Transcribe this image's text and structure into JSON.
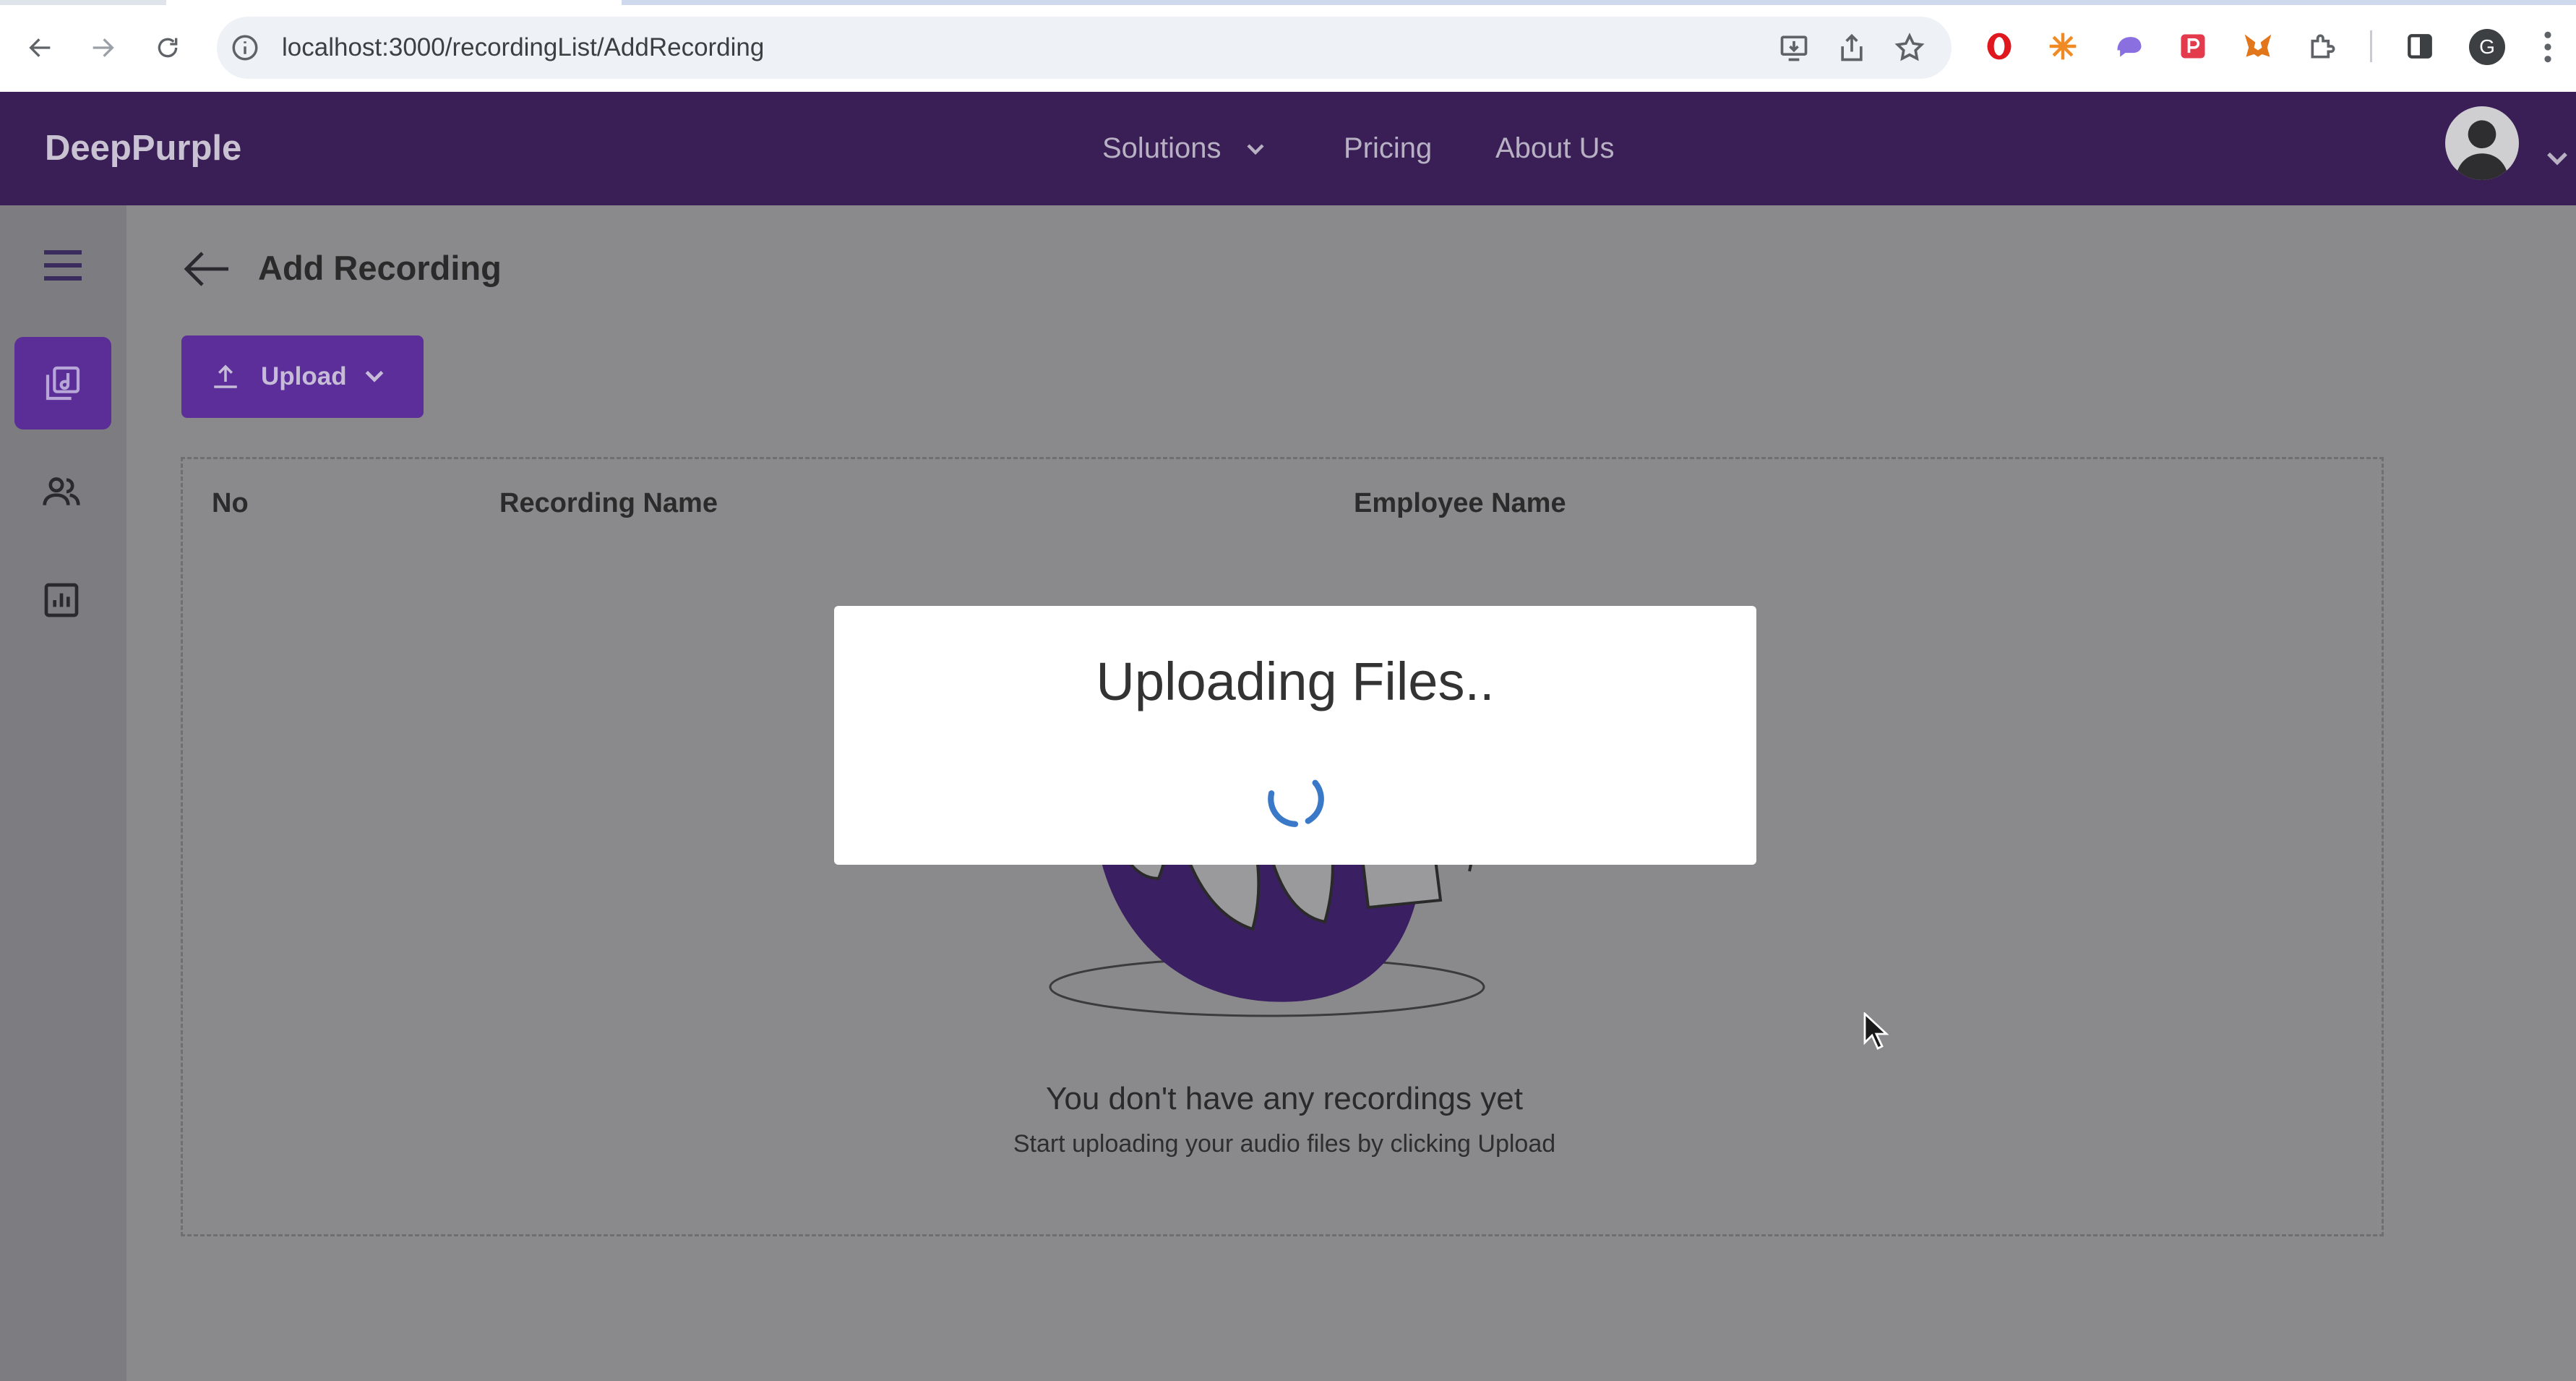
{
  "browser": {
    "url": "localhost:3000/recordingList/AddRecording",
    "profile_initial": "G"
  },
  "header": {
    "brand": "DeepPurple",
    "nav": [
      "Solutions",
      "Pricing",
      "About Us"
    ]
  },
  "page": {
    "title": "Add Recording",
    "upload_label": "Upload"
  },
  "table": {
    "columns": [
      "No",
      "Recording Name",
      "Employee Name"
    ],
    "rows": [],
    "empty_title": "You don't have any recordings yet",
    "empty_subtitle": "Start uploading your audio files by clicking Upload"
  },
  "modal": {
    "title": "Uploading Files.."
  },
  "colors": {
    "header_bg": "#3a1f57",
    "accent": "#5b2e9a",
    "spinner": "#3a78c8"
  }
}
